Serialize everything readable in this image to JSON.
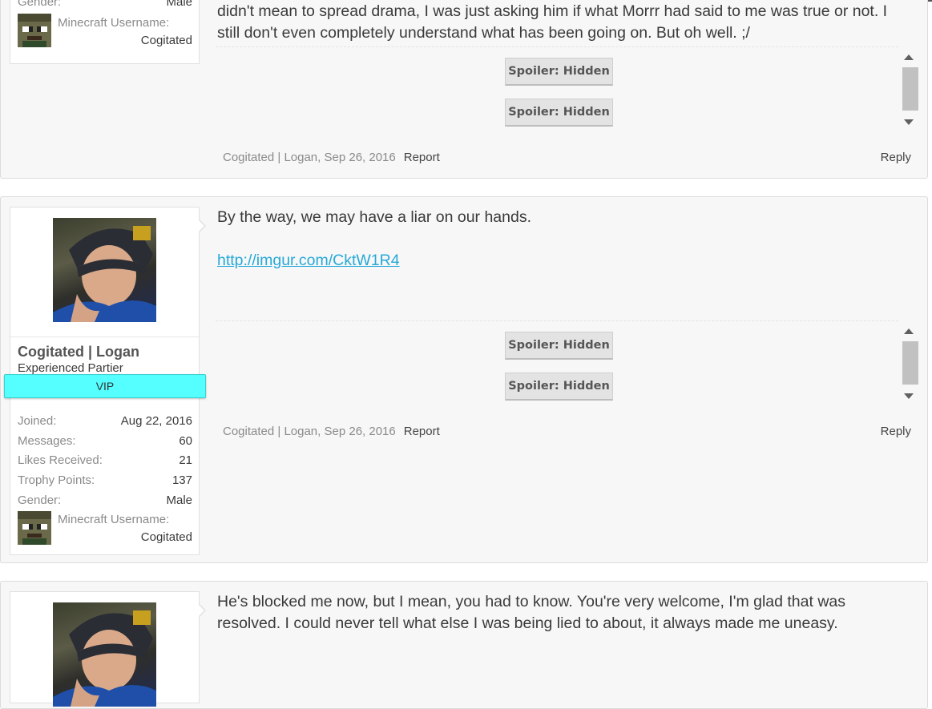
{
  "post1": {
    "partial_profile": {
      "gender_label": "Gender:",
      "gender_value": "Male",
      "mc_label": "Minecraft Username:",
      "mc_value": "Cogitated"
    },
    "message_line1": "didn't mean to spread drama, I was just asking him if what Morrr had said to me was true or not. I",
    "message_line2": "still don't even completely understand what has been going on. But oh well. ;/",
    "spoilers": [
      "Spoiler: Hidden",
      "Spoiler: Hidden"
    ],
    "meta": "Cogitated | Logan, Sep 26, 2016",
    "report": "Report",
    "reply": "Reply"
  },
  "post2": {
    "username": "Cogitated | Logan",
    "user_title": "Experienced Partier",
    "banner": "VIP",
    "stats": [
      {
        "label": "Joined:",
        "value": "Aug 22, 2016"
      },
      {
        "label": "Messages:",
        "value": "60"
      },
      {
        "label": "Likes Received:",
        "value": "21"
      },
      {
        "label": "Trophy Points:",
        "value": "137"
      },
      {
        "label": "Gender:",
        "value": "Male"
      }
    ],
    "mc_label": "Minecraft Username:",
    "mc_value": "Cogitated",
    "message": "By the way, we may have a liar on our hands.",
    "link": "http://imgur.com/CktW1R4",
    "spoilers": [
      "Spoiler: Hidden",
      "Spoiler: Hidden"
    ],
    "meta": "Cogitated | Logan, Sep 26, 2016",
    "report": "Report",
    "reply": "Reply"
  },
  "post3": {
    "message_line1": "He's blocked me now, but I mean, you had to know. You're very welcome, I'm glad that was",
    "message_line2": "resolved. I could never tell what else I was being lied to about, it always made me uneasy."
  },
  "colors": {
    "vip_banner": "#55ffff",
    "link": "#27a9d8",
    "post_bg": "#f7f7f7"
  }
}
